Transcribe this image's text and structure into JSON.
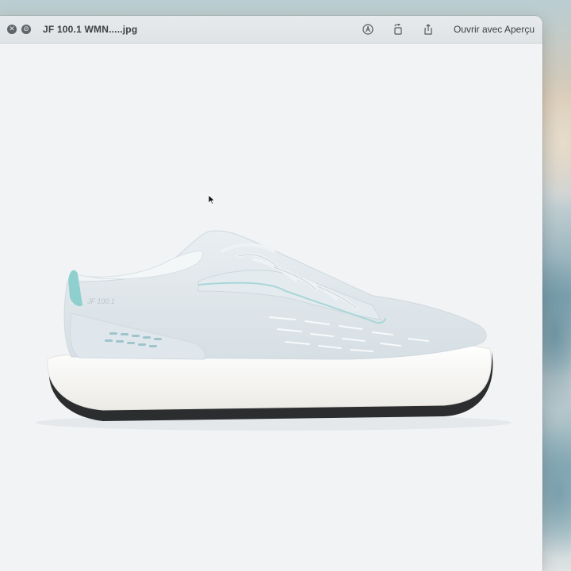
{
  "window": {
    "title": "JF 100.1 WMN.....jpg",
    "open_with_label": "Ouvrir avec Aperçu"
  },
  "toolbar_icons": [
    "markup-icon",
    "rotate-icon",
    "share-icon"
  ],
  "traffic_buttons": [
    "close-icon",
    "fullscreen-icon"
  ],
  "image": {
    "subject": "sneaker",
    "shoe_label": "JF 100.1"
  },
  "colors": {
    "titlebar": "#e2e6e8",
    "canvas": "#f1f3f5",
    "shoe_upper": "#dfe7ec",
    "shoe_sole": "#f4f4f1",
    "accent_teal": "#8fd0cf"
  }
}
